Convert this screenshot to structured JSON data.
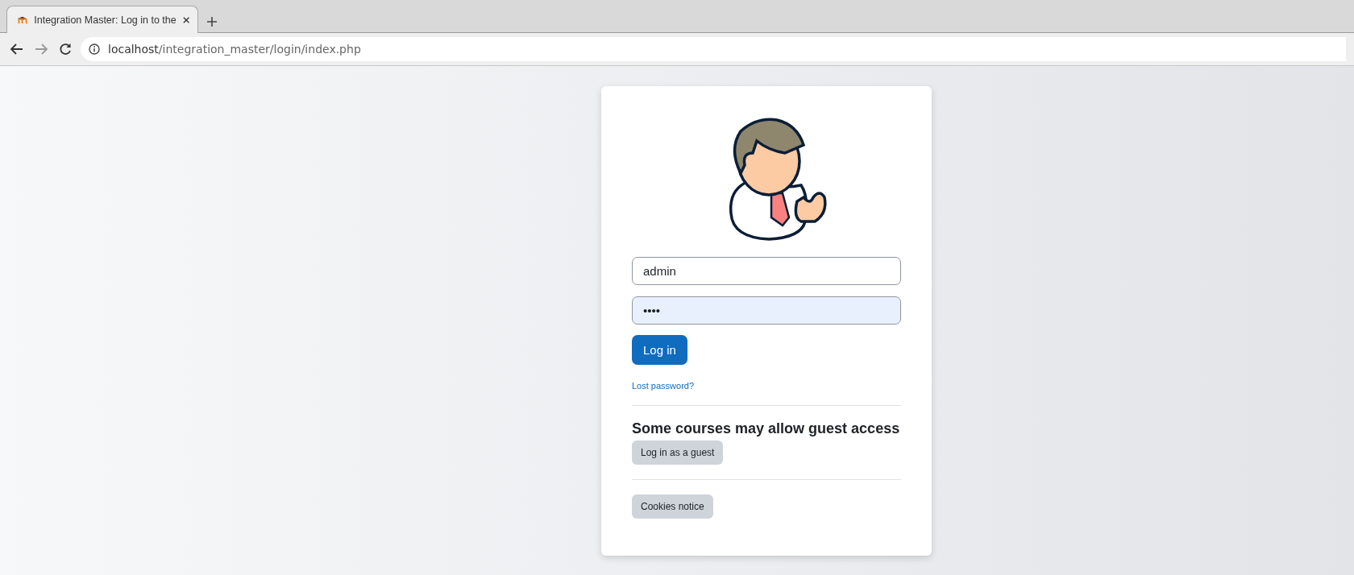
{
  "browser": {
    "tab": {
      "title": "Integration Master: Log in to the",
      "selected": true
    },
    "address": {
      "host": "localhost",
      "path": "/integration_master/login/index.php"
    }
  },
  "login": {
    "username": {
      "value": "admin"
    },
    "password": {
      "value": "••••",
      "autofilled": true
    },
    "login_button": "Log in",
    "lost_password": "Lost password?",
    "guest_heading": "Some courses may allow guest access",
    "guest_button": "Log in as a guest",
    "cookies_button": "Cookies notice"
  }
}
